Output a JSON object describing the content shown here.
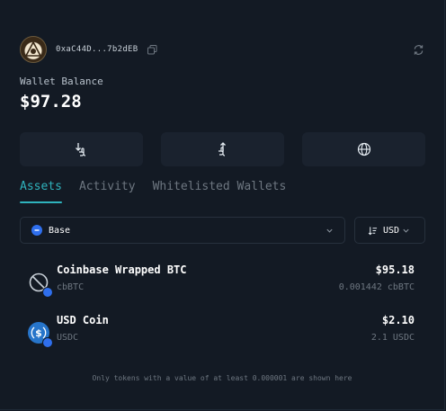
{
  "header": {
    "address": "0xaC44D...7b2dEB",
    "icons": {
      "avatar": "avatar-image",
      "copy": "copy-icon",
      "refresh": "refresh-icon"
    }
  },
  "balance": {
    "label": "Wallet Balance",
    "value": "$97.28"
  },
  "actions": [
    {
      "name": "receive",
      "icon": "receive-icon"
    },
    {
      "name": "send",
      "icon": "send-icon"
    },
    {
      "name": "web",
      "icon": "globe-icon"
    }
  ],
  "tabs": [
    {
      "label": "Assets",
      "active": true
    },
    {
      "label": "Activity",
      "active": false
    },
    {
      "label": "Whitelisted Wallets",
      "active": false
    }
  ],
  "filters": {
    "network": "Base",
    "currency": "USD"
  },
  "assets": [
    {
      "name": "Coinbase Wrapped BTC",
      "symbol": "cbBTC",
      "value": "$95.18",
      "amount": "0.001442 cbBTC"
    },
    {
      "name": "USD Coin",
      "symbol": "USDC",
      "value": "$2.10",
      "amount": "2.1 USDC"
    }
  ],
  "footnote": "Only tokens with a value of at least 0.000001 are shown here",
  "colors": {
    "background": "#131a24",
    "accent": "#2fb3bd",
    "base_blue": "#2f6fed",
    "usdc_blue": "#2775ca"
  }
}
